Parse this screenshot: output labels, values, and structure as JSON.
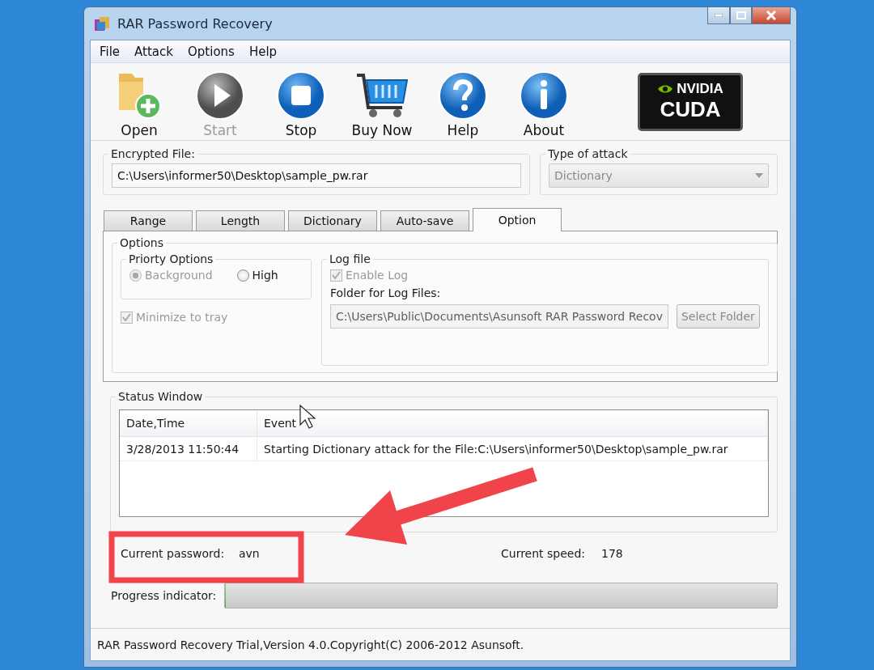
{
  "window": {
    "title": "RAR Password Recovery"
  },
  "menu": [
    "File",
    "Attack",
    "Options",
    "Help"
  ],
  "toolbar": [
    {
      "kind": "open",
      "label": "Open",
      "disabled": false
    },
    {
      "kind": "start",
      "label": "Start",
      "disabled": true
    },
    {
      "kind": "stop",
      "label": "Stop",
      "disabled": false
    },
    {
      "kind": "buy",
      "label": "Buy Now",
      "disabled": false
    },
    {
      "kind": "help",
      "label": "Help",
      "disabled": false
    },
    {
      "kind": "about",
      "label": "About",
      "disabled": false
    }
  ],
  "logo": {
    "brand": "NVIDIA",
    "product": "CUDA"
  },
  "encrypted_file": {
    "label": "Encrypted File:",
    "value": "C:\\Users\\informer50\\Desktop\\sample_pw.rar"
  },
  "attack_type": {
    "label": "Type of attack",
    "value": "Dictionary",
    "disabled": true
  },
  "tabs": [
    {
      "label": "Range",
      "selected": false
    },
    {
      "label": "Length",
      "selected": false
    },
    {
      "label": "Dictionary",
      "selected": false
    },
    {
      "label": "Auto-save",
      "selected": false
    },
    {
      "label": "Option",
      "selected": true
    }
  ],
  "options": {
    "title": "Options",
    "priority": {
      "title": "Priorty Options",
      "choices": [
        {
          "label": "Background",
          "selected": true,
          "disabled": true
        },
        {
          "label": "High",
          "selected": false,
          "disabled": false
        }
      ]
    },
    "minimize": {
      "label": "Minimize to tray",
      "checked": true,
      "disabled": true
    },
    "log": {
      "title": "Log file",
      "enable": {
        "label": "Enable Log",
        "checked": true,
        "disabled": true
      },
      "folder_label": "Folder for Log Files:",
      "folder": {
        "value": "C:\\Users\\Public\\Documents\\Asunsoft RAR Password Recov",
        "disabled": true
      },
      "select_button": {
        "label": "Select Folder",
        "disabled": true
      }
    }
  },
  "status_window": {
    "title": "Status Window",
    "columns": [
      "Date,Time",
      "Event"
    ],
    "rows": [
      [
        "3/28/2013 11:50:44",
        "Starting Dictionary attack for the File:C:\\Users\\informer50\\Desktop\\sample_pw.rar"
      ]
    ]
  },
  "current_password": {
    "label": "Current password:",
    "value": "avn"
  },
  "current_speed": {
    "label": "Current speed:",
    "value": "178"
  },
  "progress": {
    "label": "Progress indicator:",
    "level": 0
  },
  "status_bar": "RAR Password Recovery Trial,Version 4.0.Copyright(C) 2006-2012 Asunsoft."
}
